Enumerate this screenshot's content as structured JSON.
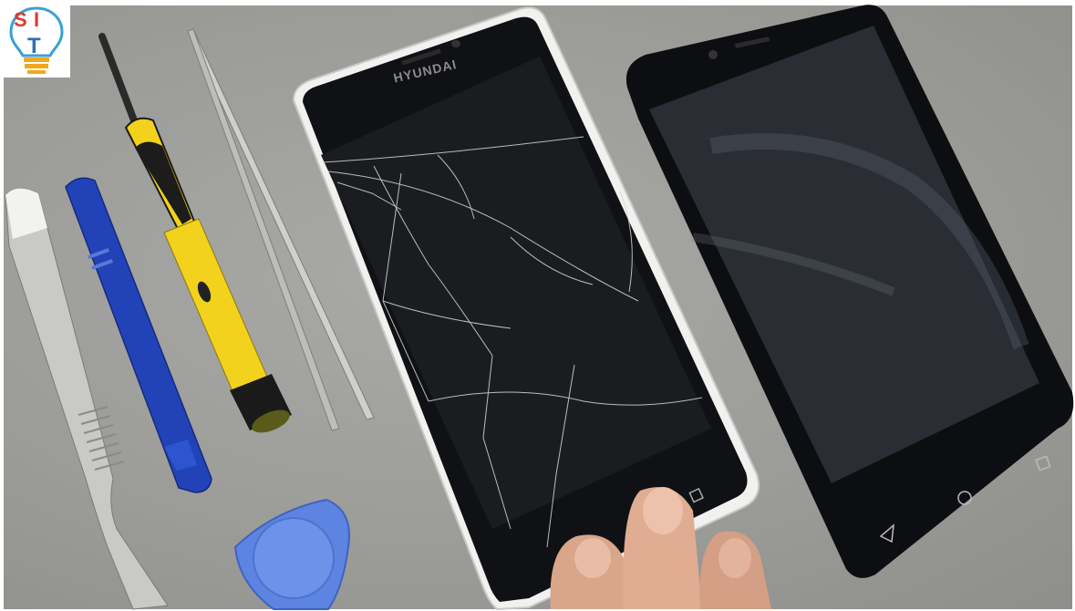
{
  "logo": {
    "letters": [
      "S",
      "I",
      "T"
    ]
  },
  "phone_left": {
    "brand": "HYUNDAI"
  },
  "colors": {
    "mat": "#9e9e9b",
    "screwdriver_handle": "#f2d21c",
    "spudger": "#2243b8",
    "pick": "#5d84e0"
  }
}
